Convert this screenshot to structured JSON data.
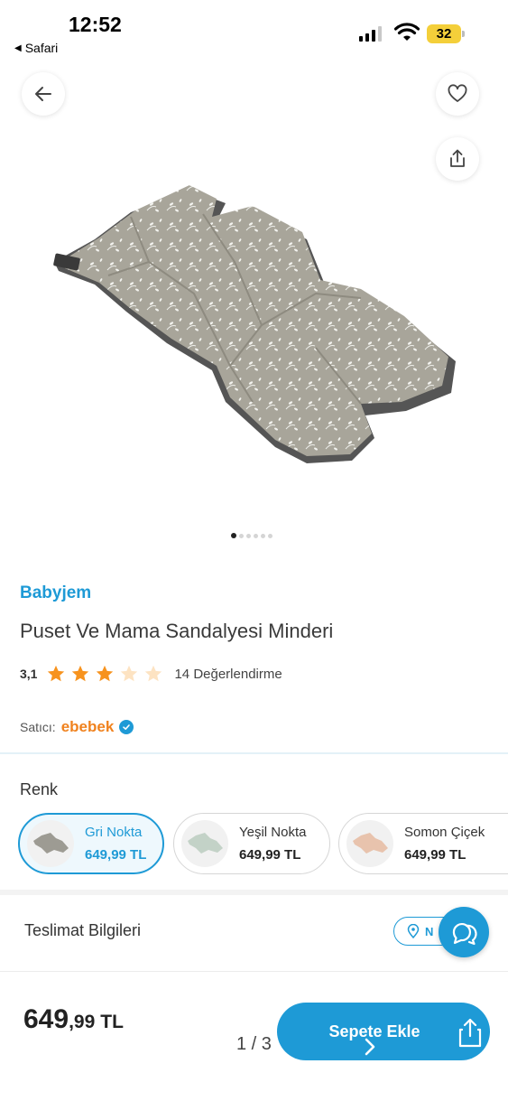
{
  "status_bar": {
    "time": "12:52",
    "back_app": "Safari",
    "battery": "32"
  },
  "icons": {
    "back": "arrow-left-icon",
    "favorite": "heart-icon",
    "share": "share-icon",
    "chat": "chat-support-icon",
    "location": "location-pin-icon",
    "verified": "verified-check-icon"
  },
  "gallery": {
    "dots_count": 6,
    "active_index": 0
  },
  "product": {
    "brand": "Babyjem",
    "title": "Puset Ve Mama Sandalyesi Minderi",
    "rating": "3,1",
    "rating_value": 3.1,
    "stars_filled": 3,
    "stars_total": 5,
    "review_count": "14 Değerlendirme",
    "seller_label": "Satıcı:",
    "seller_name": "ebebek"
  },
  "color_section": {
    "label": "Renk",
    "variants": [
      {
        "name": "Gri Nokta",
        "price": "649,99 TL",
        "selected": true
      },
      {
        "name": "Yeşil Nokta",
        "price": "649,99 TL",
        "selected": false
      },
      {
        "name": "Somon Çiçek",
        "price": "649,99 TL",
        "selected": false
      }
    ]
  },
  "delivery": {
    "label": "Teslimat Bilgileri",
    "location_button": "N"
  },
  "bottom_bar": {
    "price_main": "649",
    "price_decimal": ",99",
    "currency": "TL",
    "page_indicator": "1 / 3",
    "add_to_cart": "Sepete Ekle"
  },
  "colors": {
    "accent": "#1e9ad6",
    "seller": "#f0821e",
    "star_filled": "#f7931e",
    "star_empty": "#fde3c2"
  }
}
